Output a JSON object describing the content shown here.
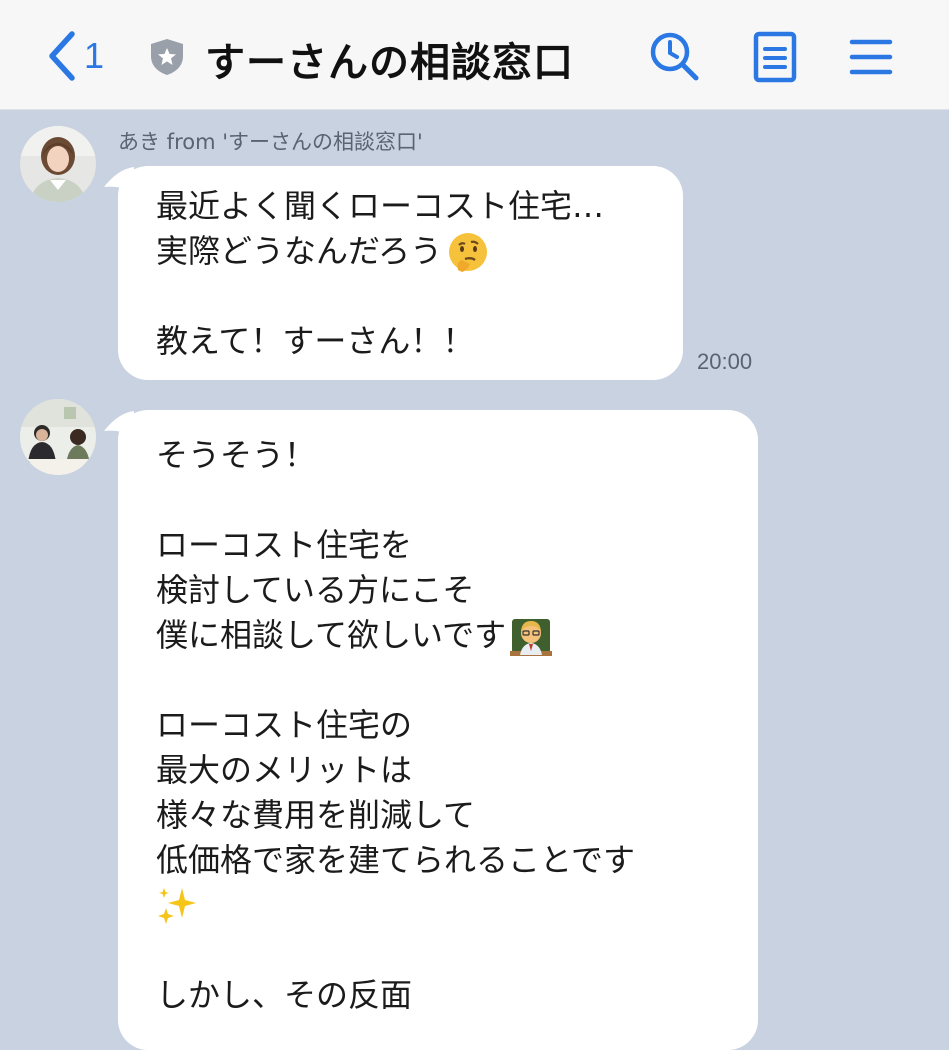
{
  "header": {
    "back_count": "1",
    "title": "すーさんの相談窓口",
    "accent_color": "#2b78e4",
    "icons": [
      "chevron-left-icon",
      "verified-badge-icon",
      "clock-search-icon",
      "note-icon",
      "menu-icon"
    ]
  },
  "messages": [
    {
      "sender": "あき from 'すーさんの相談窓口'",
      "avatar": "woman-avatar",
      "lines": [
        "最近よく聞くローコスト住宅…",
        "実際どうなんだろう",
        "",
        "教えて！すーさん！！"
      ],
      "emoji": [
        "thinking-face-emoji"
      ],
      "time": "20:00"
    },
    {
      "avatar": "consultation-avatar",
      "lines": [
        "そうそう！",
        "",
        "ローコスト住宅を",
        "検討している方にこそ",
        "僕に相談して欲しいです",
        "",
        "ローコスト住宅の",
        "最大のメリットは",
        "様々な費用を削減して",
        "低価格で家を建てられることです",
        "",
        "",
        "しかし、その反面"
      ],
      "emoji": [
        "teacher-emoji",
        "sparkles-emoji"
      ]
    }
  ]
}
